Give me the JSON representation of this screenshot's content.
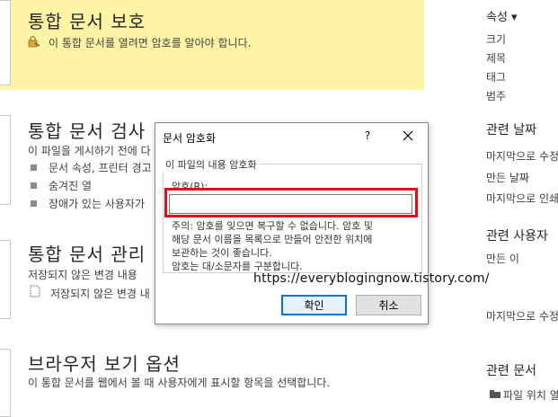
{
  "protect": {
    "title": "통합 문서 보호",
    "desc": "이 통합 문서를 열려면 암호를 알아야 합니다."
  },
  "inspect": {
    "title": "통합 문서 검사",
    "desc": "이 파일을 게시하기 전에 다",
    "bullets": [
      "문서 속성, 프린터 경고",
      "숨겨진 열",
      "장애가 있는 사용자가"
    ]
  },
  "manage": {
    "title": "통합 문서 관리",
    "desc": "저장되지 않은 변경 내용",
    "item": "저장되지 않은 변경 내"
  },
  "browser": {
    "title": "브라우저 보기 옵션",
    "desc": "이 통합 문서를 웹에서 볼 때 사용자에게 표시할 항목을 선택합니다."
  },
  "right_panel": {
    "properties_head": "속성 ▾",
    "properties": [
      "크기",
      "제목",
      "태그",
      "범주"
    ],
    "dates_head": "관련 날짜",
    "dates": [
      "마지막으로 수정",
      "만든 날짜",
      "마지막으로 인쇄"
    ],
    "people_head": "관련 사용자",
    "people": [
      "만든 이",
      "마지막으로 수정"
    ],
    "docs_head": "관련 문서",
    "docs_item": "파일 위치 열"
  },
  "dialog": {
    "title": "문서 암호화",
    "help": "?",
    "group_label": "이 파일의 내용 암호화",
    "password_label": "암호(R):",
    "password_value": "",
    "warning": [
      "주의: 암호를 잊으면 복구할 수 없습니다. 암호 및",
      "해당 문서 이름을 목록으로 만들어 안전한 위치에",
      "보관하는 것이 좋습니다.",
      "암호는 대/소문자를 구분합니다."
    ],
    "ok_label": "확인",
    "cancel_label": "취소"
  },
  "watermark": "https://everyblogingnow.tistory.com/",
  "colors": {
    "protect_bg": "#fff4a6",
    "highlight": "#e0101a",
    "primary_border": "#0078d7"
  }
}
